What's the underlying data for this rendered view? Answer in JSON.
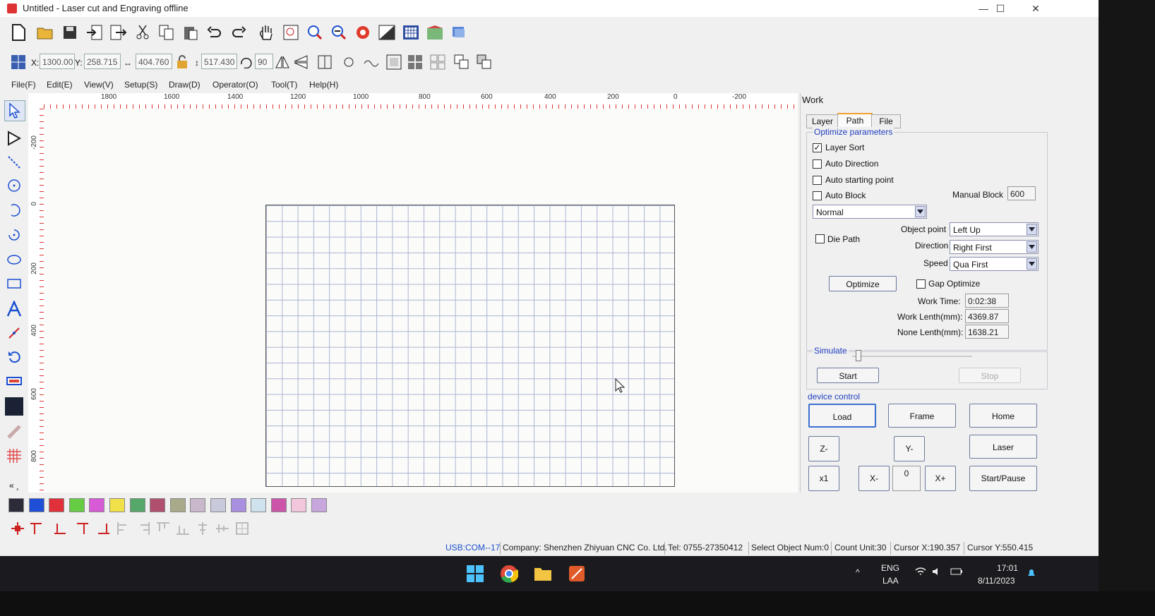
{
  "window": {
    "title": "Untitled - Laser cut and Engraving offline",
    "minimize": "—",
    "maximize": "☐",
    "close": "✕"
  },
  "toolbar": {
    "icons": [
      "new-file-icon",
      "open-folder-icon",
      "save-icon",
      "import-icon",
      "export-icon",
      "cut-icon",
      "copy-icon",
      "paste-icon",
      "undo-icon",
      "redo-icon",
      "pan-hand-icon",
      "zoom-box-icon",
      "zoom-in-icon",
      "zoom-out-icon",
      "settings-gear-icon",
      "display-mode-icon",
      "grid-icon",
      "array-icon",
      "device-icon"
    ]
  },
  "property_bar": {
    "x_label": "X:",
    "x_value": "1300.00",
    "y_label": "Y:",
    "y_value": "258.715",
    "width_value": "404.760",
    "height_value": "517.430",
    "rotate_value": "90"
  },
  "menu": [
    "File(F)",
    "Edit(E)",
    "View(V)",
    "Setup(S)",
    "Draw(D)",
    "Operator(O)",
    "Tool(T)",
    "Help(H)"
  ],
  "ruler": {
    "top": [
      "1800",
      "1600",
      "1400",
      "1200",
      "1000",
      "800",
      "600",
      "400",
      "200",
      "0",
      "-200"
    ],
    "left": [
      "-200",
      "0",
      "200",
      "400",
      "600",
      "800"
    ]
  },
  "palette": [
    "#2b2b3a",
    "#1f4fd6",
    "#e0303a",
    "#66cc44",
    "#d75ad7",
    "#f0e04a",
    "#55a86a",
    "#b0506e",
    "#a9aa8a",
    "#c9b8cc",
    "#c9c9dc",
    "#a98fe0",
    "#cfe3ee",
    "#cc55aa",
    "#f2c6dc",
    "#c7a6dd"
  ],
  "work_panel": {
    "title": "Work",
    "tabs": [
      "Layer",
      "Path",
      "File"
    ],
    "active_tab": "Path",
    "optimize_group": "Optimize parameters",
    "layer_sort": "Layer Sort",
    "layer_sort_checked": true,
    "auto_direction": "Auto Direction",
    "auto_starting_point": "Auto starting point",
    "auto_block": "Auto Block",
    "manual_block_label": "Manual Block",
    "manual_block_value": "600",
    "mode_select": "Normal",
    "die_path": "Die Path",
    "object_point_label": "Object point",
    "object_point_value": "Left Up",
    "direction_label": "Direction",
    "direction_value": "Right First",
    "speed_label": "Speed",
    "speed_value": "Qua First",
    "optimize_button": "Optimize",
    "gap_optimize": "Gap Optimize",
    "work_time_label": "Work Time:",
    "work_time_value": "0:02:38",
    "work_length_label": "Work Lenth(mm):",
    "work_length_value": "4369.87",
    "none_length_label": "None Lenth(mm):",
    "none_length_value": "1638.21",
    "simulate_label": "Simulate",
    "simulate_progress": 0.03,
    "start_button": "Start",
    "stop_button": "Stop",
    "device_control": "device control",
    "load_button": "Load",
    "frame_button": "Frame",
    "home_button": "Home",
    "z_minus": "Z-",
    "y_minus": "Y-",
    "laser_button": "Laser",
    "x1_button": "x1",
    "x_minus": "X-",
    "step_value": "0",
    "x_plus": "X+",
    "start_pause_button": "Start/Pause"
  },
  "status": {
    "port": "USB:COM--17",
    "company": "Company: Shenzhen Zhiyuan CNC Co. Ltd.",
    "tel": "Tel: 0755-27350412",
    "select_num": "Select Object Num:0",
    "count_unit": "Count Unit:30",
    "cursor_x": "Cursor X:190.357",
    "cursor_y": "Cursor Y:550.415"
  },
  "taskbar": {
    "lang_top": "ENG",
    "lang_bottom": "LAA",
    "time": "17:01",
    "date": "8/11/2023"
  }
}
